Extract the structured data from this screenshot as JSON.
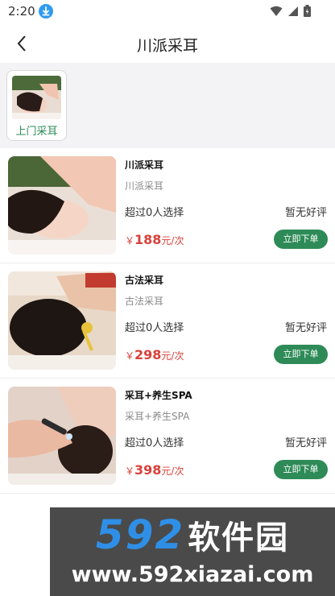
{
  "status_bar": {
    "time": "2:20"
  },
  "nav": {
    "title": "川派采耳"
  },
  "category": {
    "label": "上门采耳"
  },
  "services": [
    {
      "title": "川派采耳",
      "subtitle": "川派采耳",
      "count": "超过0人选择",
      "review": "暂无好评",
      "currency": "￥",
      "price": "188",
      "unit": "元/次",
      "button": "立即下单"
    },
    {
      "title": "古法采耳",
      "subtitle": "古法采耳",
      "count": "超过0人选择",
      "review": "暂无好评",
      "currency": "￥",
      "price": "298",
      "unit": "元/次",
      "button": "立即下单"
    },
    {
      "title": "采耳+养生SPA",
      "subtitle": "采耳+养生SPA",
      "count": "超过0人选择",
      "review": "暂无好评",
      "currency": "￥",
      "price": "398",
      "unit": "元/次",
      "button": "立即下单"
    }
  ],
  "watermark": {
    "digits": "592",
    "text": "软件园",
    "url": "www.592xiazai.com"
  },
  "colors": {
    "accent": "#2e8b57",
    "price": "#d8413a",
    "category_bg": "#f3f3f5"
  }
}
